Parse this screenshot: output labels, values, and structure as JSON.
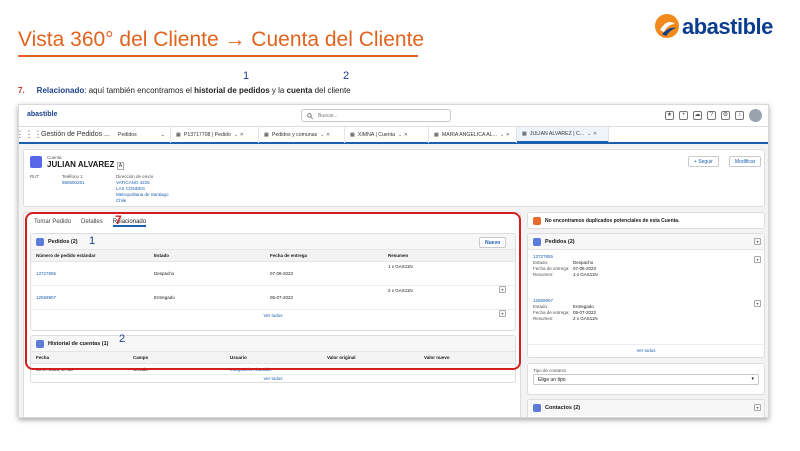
{
  "slide": {
    "title": "Vista 360° del Cliente → Cuenta del Cliente",
    "logo": "abastible",
    "step_number": "7.",
    "step_keyword": "Relacionado",
    "step_text_a": ": aquí también encontramos el ",
    "step_kw2": "historial de pedidos",
    "step_text_b": " y la ",
    "step_kw3": "cuenta",
    "step_text_c": " del cliente",
    "marker_1": "1",
    "marker_2": "2",
    "marker_7": "7",
    "brand_colors": {
      "orange": "#e2631d",
      "blue": "#1a3f8f",
      "highlight": "#d11e1e"
    }
  },
  "app": {
    "logo": "abastible",
    "search_placeholder": "Buscar...",
    "app_name": "Gestión de Pedidos ...",
    "tabs": [
      {
        "label": "Pedidos"
      },
      {
        "label": "P13717708 | Pedido"
      },
      {
        "label": "Pedidos y comunas"
      },
      {
        "label": "XIMNA | Cuenta"
      },
      {
        "label": "MARIA ANGELICA AL..."
      },
      {
        "label": "JULIAN ALVAREZ | C..."
      }
    ]
  },
  "header": {
    "object_type": "Cuenta",
    "name": "JULIAN ALVAREZ",
    "follow_label": "+ Seguir",
    "edit_label": "Modificar",
    "rut_label": "RUT",
    "phone_label": "Teléfono 1",
    "phone_value": "965550261",
    "address_label": "Dirección de envío",
    "address_lines": [
      "VATICANO 4226",
      "LAS CONDES",
      "Metropolitana de Santiago",
      "Chile"
    ]
  },
  "main_tabs": [
    "Tomar Pedido",
    "Detalles",
    "Relacionado"
  ],
  "orders": {
    "title": "Pedidos (2)",
    "new_label": "Nuevo",
    "columns": [
      "Número de pedido estándar",
      "Estado",
      "Fecha de entrega",
      "Resumen"
    ],
    "rows": [
      {
        "number": "13727855",
        "status": "Despacho",
        "date": "07-08-2023",
        "summary": "1 x GAS11N"
      },
      {
        "number": "12559907",
        "status": "Entregado",
        "date": "05-07-2022",
        "summary": "2 x GAS11N"
      }
    ],
    "view_all": "Ver todos"
  },
  "history": {
    "title": "Historial de cuentas (1)",
    "columns": [
      "Fecha",
      "Campo",
      "Usuario",
      "Valor original",
      "Valor nuevo"
    ],
    "rows": [
      {
        "date": "05-07-2023, 17:18",
        "field": "Creado",
        "user": "Integración Abastible",
        "original": "",
        "new": ""
      }
    ],
    "view_all": "Ver todos"
  },
  "side": {
    "dup_text": "No encontramos duplicados potenciales de esta Cuenta.",
    "orders_title": "Pedidos (2)",
    "labels": [
      "Estado:",
      "Fecha de entrega:",
      "Resumen:"
    ],
    "orders": [
      {
        "number": "13727855",
        "status": "Despacho",
        "date": "07-08-2023",
        "summary": "1 x GAS11N"
      },
      {
        "number": "12559907",
        "status": "Entregado",
        "date": "05-07-2022",
        "summary": "2 x GAS11N"
      }
    ],
    "view_all": "Ver todos",
    "contact_type_label": "Tipo de contacto",
    "contact_type_value": "Elige un tipo",
    "contacts_title": "Contactos (2)"
  }
}
